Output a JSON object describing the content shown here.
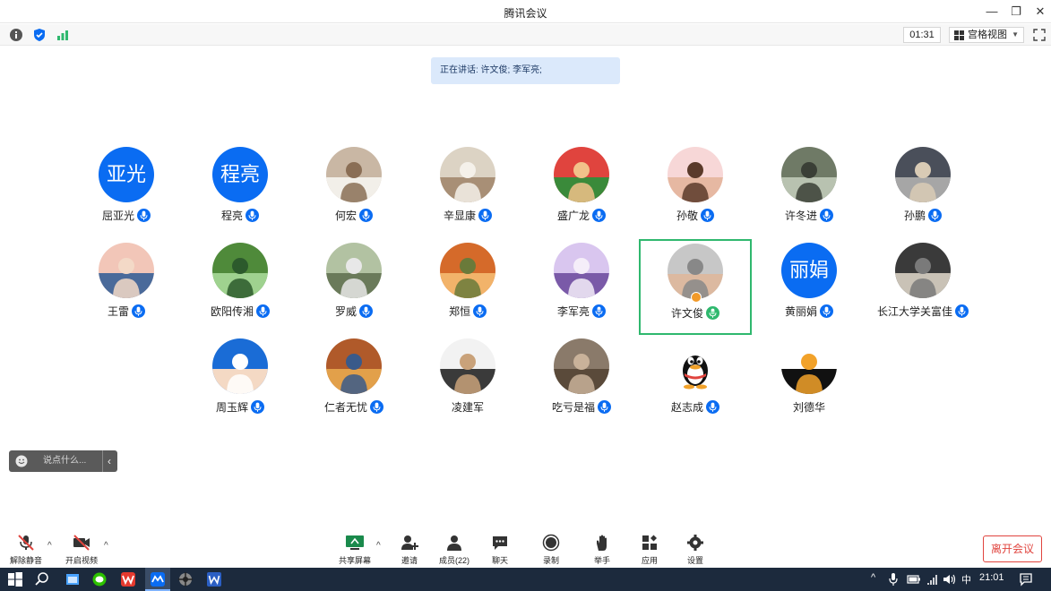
{
  "window": {
    "title": "腾讯会议"
  },
  "infobar": {
    "timer": "01:31",
    "view_label": "宫格视图"
  },
  "speaking": {
    "text": "正在讲话: 许文俊; 李军亮;"
  },
  "participants": [
    {
      "name": "屈亚光",
      "avatar_text": "亚光",
      "mic": "on"
    },
    {
      "name": "程亮",
      "avatar_text": "程亮",
      "mic": "on"
    },
    {
      "name": "何宏",
      "mic": "on"
    },
    {
      "name": "辛显康",
      "mic": "on"
    },
    {
      "name": "盛广龙",
      "mic": "on"
    },
    {
      "name": "孙敬",
      "mic": "on"
    },
    {
      "name": "许冬进",
      "mic": "on"
    },
    {
      "name": "孙鹏",
      "mic": "on"
    },
    {
      "name": "王雷",
      "mic": "on"
    },
    {
      "name": "欧阳传湘",
      "mic": "on"
    },
    {
      "name": "罗威",
      "mic": "on"
    },
    {
      "name": "郑恒",
      "mic": "on"
    },
    {
      "name": "李军亮",
      "mic": "speaking"
    },
    {
      "name": "许文俊",
      "mic": "speaking",
      "highlighted": true
    },
    {
      "name": "黄丽娟",
      "avatar_text": "丽娟",
      "mic": "on"
    },
    {
      "name": "长江大学关富佳",
      "mic": "on"
    },
    {
      "name": "周玉辉",
      "mic": "on"
    },
    {
      "name": "仁者无忧",
      "mic": "on"
    },
    {
      "name": "凌建军",
      "mic": "none"
    },
    {
      "name": "吃亏是福",
      "mic": "on"
    },
    {
      "name": "赵志成",
      "mic": "on"
    },
    {
      "name": "刘德华",
      "mic": "none"
    }
  ],
  "chat": {
    "placeholder": "说点什么..."
  },
  "toolbar": {
    "unmute": "解除静音",
    "start_video": "开启视频",
    "share_screen": "共享屏幕",
    "invite": "邀请",
    "members": "成员(22)",
    "chat": "聊天",
    "record": "录制",
    "raise_hand": "举手",
    "apps": "应用",
    "settings": "设置",
    "leave": "离开会议"
  },
  "taskbar": {
    "ime": "中",
    "clock": "21:01"
  },
  "colors": {
    "brand_blue": "#0a6cf2",
    "highlight_green": "#2fb86e",
    "leave_red": "#e0443e"
  }
}
